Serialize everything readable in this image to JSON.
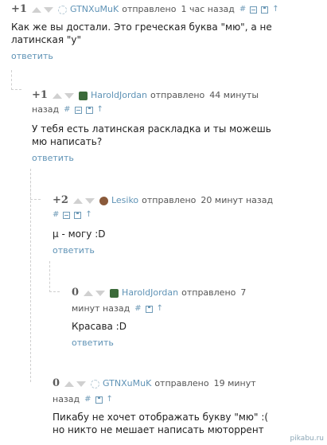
{
  "comments": [
    {
      "rating": "+1",
      "author": "GTNXuMuK",
      "sent": "отправлено",
      "time": "1 час назад",
      "body": [
        "Как же вы достали. Это греческая буква \"мю\", а не",
        "латинская \"у\""
      ],
      "reply": "ответить"
    },
    {
      "rating": "+1",
      "author": "HaroldJordan",
      "sent": "отправлено",
      "time_a": "44 минуты",
      "time_b": "назад",
      "body": [
        "У тебя есть латинская раскладка и ты можешь",
        "мю написать?"
      ],
      "reply": "ответить"
    },
    {
      "rating": "+2",
      "author": "Lesiko",
      "sent": "отправлено",
      "time": "20 минут назад",
      "body": [
        "μ - могу :D"
      ],
      "reply": "ответить"
    },
    {
      "rating": "0",
      "author": "HaroldJordan",
      "sent": "отправлено",
      "time_a": "7",
      "time_b": "минут назад",
      "body": [
        "Красава :D"
      ],
      "reply": "ответить"
    },
    {
      "rating": "0",
      "author": "GTNXuMuK",
      "sent": "отправлено",
      "time_a": "19 минут",
      "time_b": "назад",
      "body": [
        "Пикабу не хочет отображать букву \"мю\" :(",
        "но никто не мешает написать мюторрент"
      ],
      "reply": ""
    }
  ],
  "icons": {
    "hash": "#",
    "up": "↑"
  },
  "watermark": "pikabu.ru"
}
